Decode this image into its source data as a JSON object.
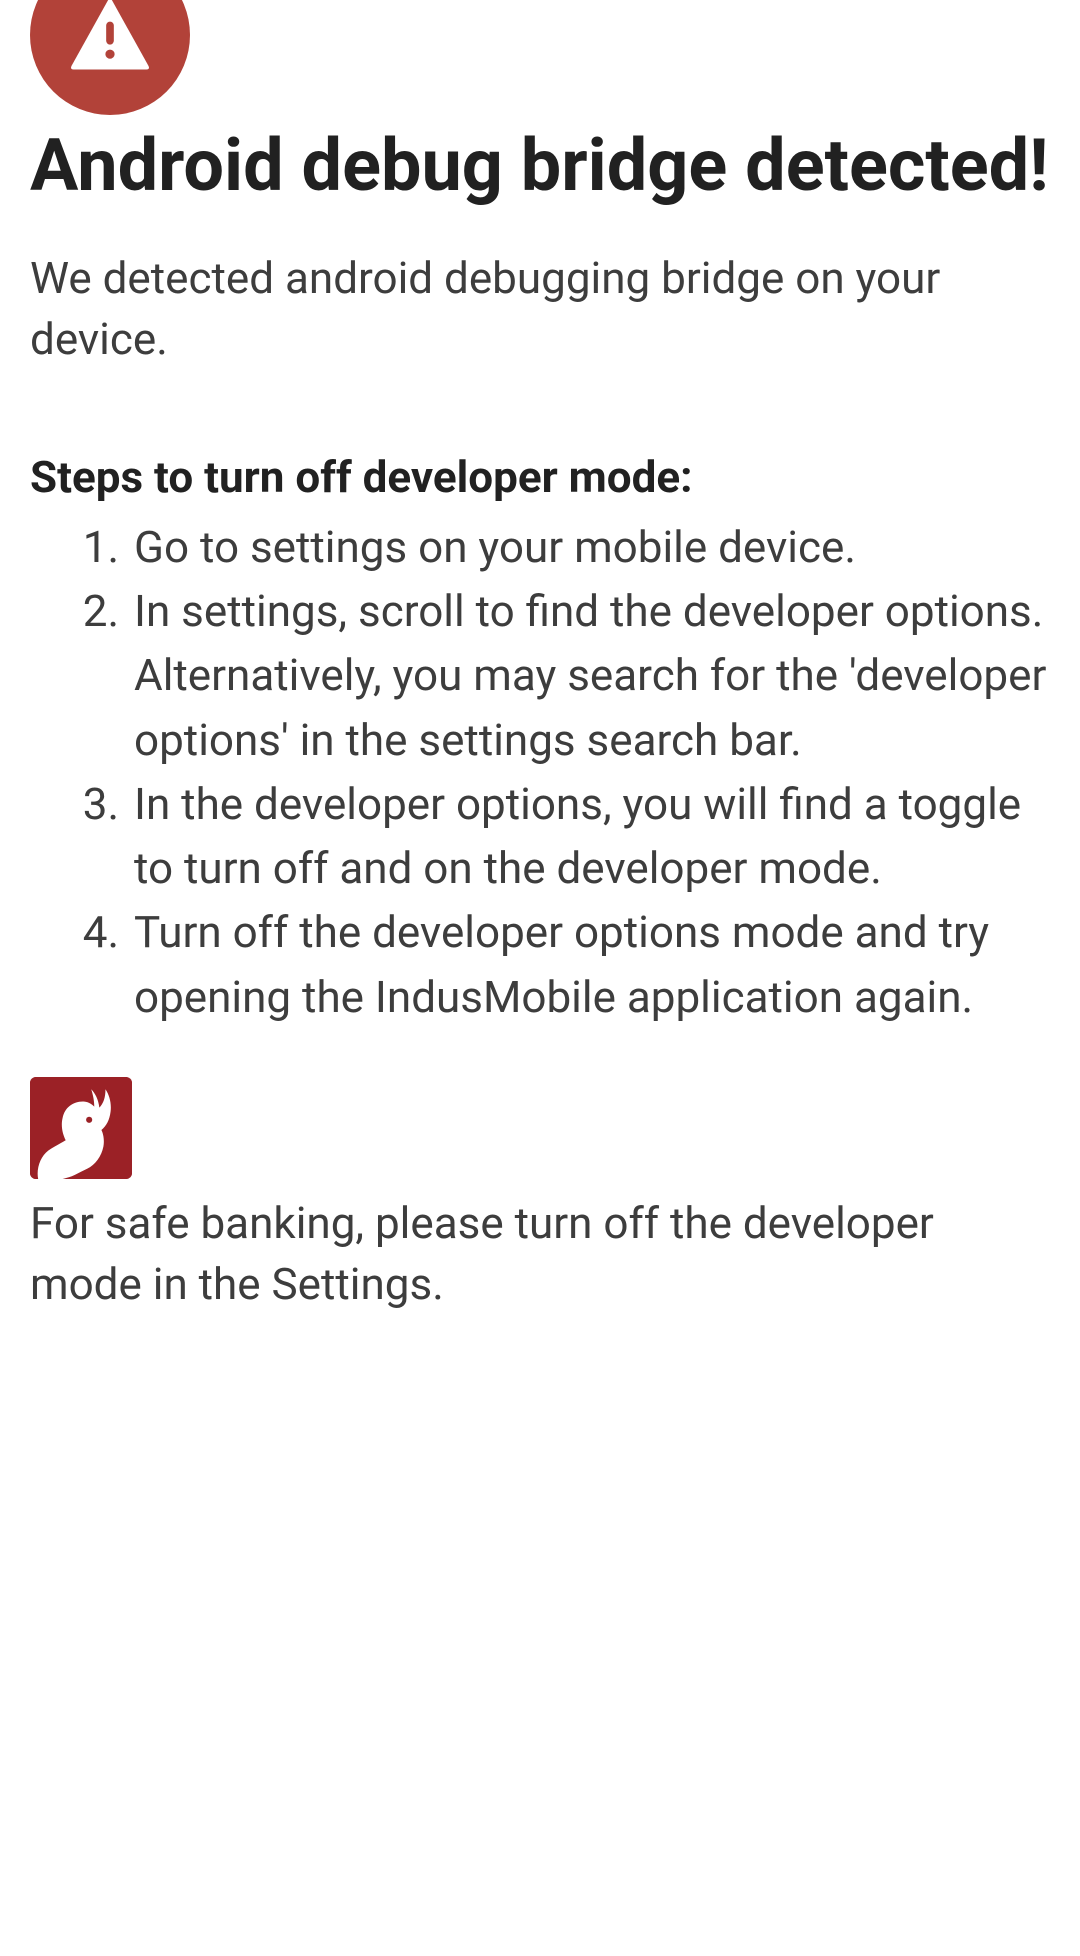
{
  "colors": {
    "warning_bg": "#b24239",
    "app_icon_bg": "#9b2126"
  },
  "icons": {
    "warning": "warning-triangle-icon",
    "app": "bull-silhouette-icon"
  },
  "header": {
    "title": "Android debug bridge detected!"
  },
  "description": "We detected android debugging bridge on your device.",
  "steps": {
    "heading": "Steps to turn off developer mode:",
    "items": [
      "Go to settings on your mobile device.",
      "In settings, scroll to find the developer options. Alternatively, you may search for the 'developer options' in the settings search bar.",
      "In the developer options, you will find a toggle to turn off and on the developer mode.",
      "Turn off the developer options mode and try opening the IndusMobile application again."
    ]
  },
  "footer": {
    "text": "For safe banking, please turn off the developer mode in the Settings."
  }
}
